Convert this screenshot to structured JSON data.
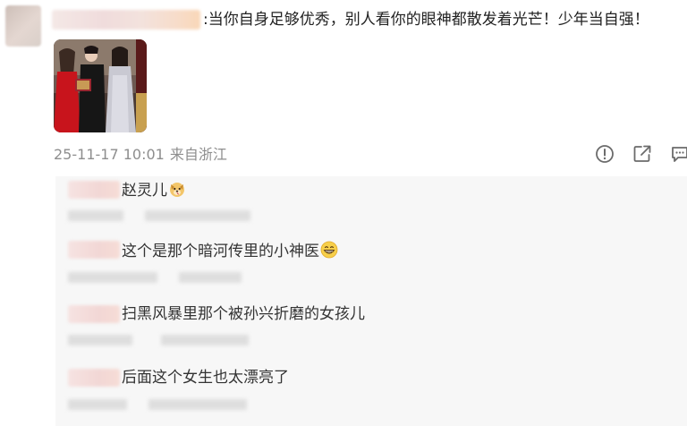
{
  "post": {
    "comment_text": ":当你自身足够优秀，别人看你的眼神都散发着光芒！少年当自强！",
    "timestamp": "25-11-17 10:01",
    "location": "来自浙江",
    "actions": [
      "report-icon",
      "share-icon",
      "comment-icon"
    ]
  },
  "replies": [
    {
      "text": "赵灵儿",
      "emoji": "dog-emoji"
    },
    {
      "text": "这个是那个暗河传里的小神医",
      "emoji": "grin-emoji"
    },
    {
      "text": "扫黑风暴里那个被孙兴折磨的女孩儿",
      "emoji": ""
    },
    {
      "text": "后面这个女生也太漂亮了",
      "emoji": ""
    }
  ],
  "colors": {
    "text_primary": "#222222",
    "text_meta": "#8e8e8e",
    "reply_background": "#f7f7f7",
    "icon_gray": "#6b6b6b"
  }
}
